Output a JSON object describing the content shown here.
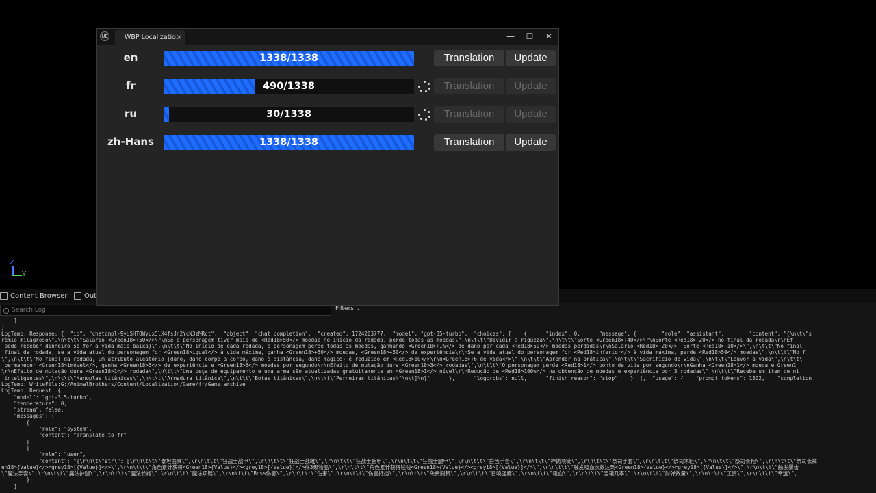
{
  "viewport": {
    "axis_z": "Z",
    "axis_y": "Y"
  },
  "window": {
    "tab_title": "WBP Localizatio..",
    "tab_close": "×",
    "logo": "UE",
    "min": "—",
    "max": "☐",
    "close": "✕"
  },
  "languages": [
    {
      "code": "en",
      "progress_text": "1338/1338",
      "done": 1338,
      "total": 1338,
      "translation_label": "Translation",
      "update_label": "Update",
      "busy": false
    },
    {
      "code": "fr",
      "progress_text": "490/1338",
      "done": 490,
      "total": 1338,
      "translation_label": "Translation",
      "update_label": "Update",
      "busy": true
    },
    {
      "code": "ru",
      "progress_text": "30/1338",
      "done": 30,
      "total": 1338,
      "translation_label": "Translation",
      "update_label": "Update",
      "busy": true
    },
    {
      "code": "zh-Hans",
      "progress_text": "1338/1338",
      "done": 1338,
      "total": 1338,
      "translation_label": "Translation",
      "update_label": "Update",
      "busy": false
    }
  ],
  "bottom_tabs": {
    "content_browser": "Content Browser",
    "output": "Outp"
  },
  "log_toolbar": {
    "search_placeholder": "Search Log",
    "filters": "Filters ⌄"
  },
  "log_text": "    ]\n}\nLogTemp: Response: {  \"id\": \"chatcmpl-9yUSHTOWyux5lX4fsJn2YcN3zMRct\",  \"object\": \"chat.completion\",  \"created\": 1724203777,  \"model\": \"gpt-35-turbo\",  \"choices\": [    {      \"index\": 0,      \"message\": {        \"role\": \"assistant\",        \"content\": \"{\\n\\t\\\"s\nrêmio milagroso\\\",\\n\\t\\t\\\"Salário <Green18>+50</>\\r\\nSe o personagem tiver mais de <Red18>50</> moedas no início da rodada, perde todas as moedas\\\",\\n\\t\\t\\\"Dividir a riqueza\\\",\\n\\t\\t\\\"Sorte <Green18>+40</>\\r\\nSorte <Red18>-20</> no final da rodada\\r\\nEf\n pode receber dinheiro se for a vida mais baixa)\\\",\\n\\t\\t\\\"No início de cada rodada, o personagem perde todas as moedas, ganhando <Green18>+1%</> de dano por cada <Red18>50</> moedas perdidas\\r\\nSalário <Red18>-20</>  Sorte <Red18>-10</>\\\",\\n\\t\\t\\\"No final\n final da rodada, se a vida atual do personagem for <Green18>igual</> à vida máxima, ganha <Green18>+50</> moedas, <Green18>+50</> de experiência\\r\\nSe a vida atual do personagem for <Red18>inferior</> à vida máxima, perde <Red18>50</> moedas\\\",\\n\\t\\t\\\"No f\n\\\",\\n\\t\\t\\\"No final da rodada, um atributo aleatório (dano, dano corpo a corpo, dano à distância, dano mágico) é reduzido em <Red18>10</>\\r\\n<Green18>+6 de vida</>\\\",\\n\\t\\t\\\"Aprender na prática\\\",\\n\\t\\t\\\"Sacrifício de vida\\\",\\n\\t\\t\\\"Louvor à vida\\\",\\n\\t\\t\\\n permanecer <Green18>imóvel</>, ganha <Green18>5</> de experiência e <Green18>5</> moedas por segundo\\r\\nEfeito de mutação dura <Green18>3</> rodadas\\\",\\n\\t\\t\\\"O personagem perde <Red18>1</> ponto de vida por segundo\\r\\nGanha <Green18>1</> moeda e Green1\n\\r\\nEfeito de mutação dura <Green18>1</> rodada\\\",\\n\\t\\t\\\"Uma peça de equipamento e uma arma são atualizadas gratuitamente em <Green18>1</> nível\\r\\nRedução de <Red18>100%</> na obtenção de moedas e experiência por 3 rodadas\\\",\\n\\t\\t\\\"Recebe um item de ni\n inteligentes\\\",\\n\\t\\t\\\"Manoplas titânicas\\\",\\n\\t\\t\\\"Armadura titânica\\\",\\n\\t\\t\\\"Botas titânicas\\\",\\n\\t\\t\\\"Perneiras titânicas\\\"\\n\\t]\\n}\"      },      \"logprobs\": null,      \"finish_reason\": \"stop\"    }  ],  \"usage\": {    \"prompt_tokens\": 1502,    \"completion\nLogTemp: WriteFile:G:/AnimalBrothers/Content/Localization/Game/fr/Game.archive\nLogTemp: Request: {\n    \"model\": \"gpt-3.5-turbo\",\n    \"temperature\": 0,\n    \"stream\": false,\n    \"messages\": [\n        {\n            \"role\": \"system\",\n            \"content\": \"Translate to fr\"\n        },\n        {\n            \"role\": \"user\",\n            \"content\": \"{\\r\\n\\t\\\"str\\\": [\\r\\n\\t\\t\\\"泰坦面具\\\",\\r\\n\\t\\t\\\"狂战士战甲\\\",\\r\\n\\t\\t\\\"狂战士战靴\\\",\\r\\n\\t\\t\\\"狂战士腕甲\\\",\\r\\n\\t\\t\\\"狂战士腿甲\\\",\\r\\n\\t\\t\\\"白色手套\\\",\\r\\n\\t\\t\\\"神铸项链\\\",\\r\\n\\t\\t\\\"祭司手套\\\",\\r\\n\\t\\t\\\"祭司木鞋\\\",\\r\\n\\t\\t\\\"祭司长袍\\\",\\r\\n\\t\\t\\\"祭司长裤\nen18>{Value}</><grey18>[{Value}]</>\\\",\\r\\n\\t\\t\\\"角色累计获得<Green18>{Value}</><grey18>[{Value}]</>件3级物品\\\",\\r\\n\\t\\t\\\"角色累计获得钱钱<Green18>{Value}</><grey18>[{Value}]</>\\\",\\r\\n\\t\\t\\\"触发吸血次数达到<Green18>{Value}</><grey18>[{Value}]</>\\\",\\r\\n\\t\\t\\\"触发暴击\n\\\"魔法手套\\\",\\r\\n\\t\\t\\\"魔法护腿\\\",\\r\\n\\t\\t\\\"魔法长袍\\\",\\r\\n\\t\\t\\\"魔法项链\\\",\\r\\n\\t\\t\\\"Boss伤害\\\",\\r\\n\\t\\t\\\"伤害\\\",\\r\\n\\t\\t\\\"伤害抵挡\\\",\\r\\n\\t\\t\\\"免费刷新\\\",\\r\\n\\t\\t\\\"召唤强度\\\",\\r\\n\\t\\t\\\"吸血\\\",\\r\\n\\t\\t\\\"宝箱几率\\\",\\r\\n\\t\\t\\\"射弹数量\\\",\\r\\n\\t\\t\\\"工资\\\",\\r\\n\\t\\t\\\"幸运\\\",\n        }\n    ]"
}
